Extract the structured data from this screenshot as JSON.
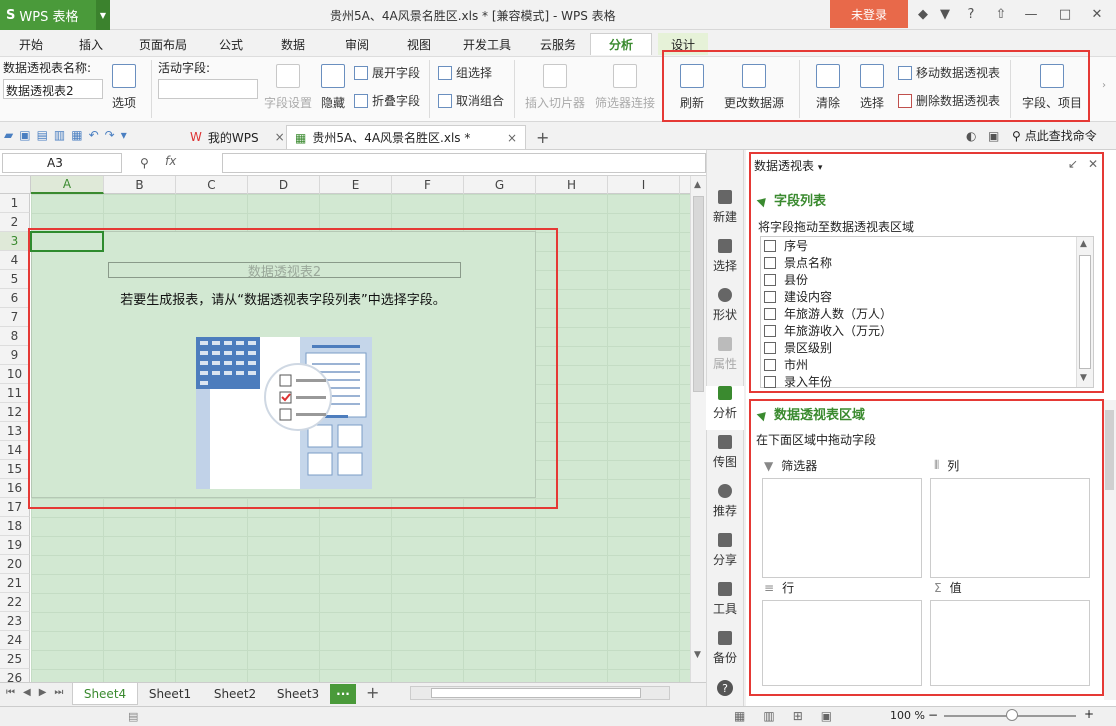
{
  "app": {
    "name": "WPS 表格",
    "doc_title": "贵州5A、4A风景名胜区.xls * [兼容模式] - WPS 表格",
    "login": "未登录"
  },
  "menu_tabs": [
    "开始",
    "插入",
    "页面布局",
    "公式",
    "数据",
    "审阅",
    "视图",
    "开发工具",
    "云服务",
    "分析",
    "设计"
  ],
  "ribbon": {
    "pivot_name_label": "数据透视表名称:",
    "pivot_name_value": "数据透视表2",
    "options": "选项",
    "active_field_label": "活动字段:",
    "field_settings": "字段设置",
    "hide": "隐藏",
    "expand_field": "展开字段",
    "collapse_field": "折叠字段",
    "group_select": "组选择",
    "ungroup": "取消组合",
    "insert_slicer": "插入切片器",
    "filter_connect": "筛选器连接",
    "refresh": "刷新",
    "change_source": "更改数据源",
    "clear": "清除",
    "select": "选择",
    "move_pivot": "移动数据透视表",
    "delete_pivot": "删除数据透视表",
    "fields_items": "字段、项目"
  },
  "file_tabs": {
    "mywps": "我的WPS",
    "file": "贵州5A、4A风景名胜区.xls *",
    "search": "点此查找命令"
  },
  "formula": {
    "namebox": "A3",
    "fx": "fx"
  },
  "grid": {
    "columns": [
      "A",
      "B",
      "C",
      "D",
      "E",
      "F",
      "G",
      "H",
      "I"
    ],
    "rows": [
      "1",
      "2",
      "3",
      "4",
      "5",
      "6",
      "7",
      "8",
      "9",
      "10",
      "11",
      "12",
      "13",
      "14",
      "15",
      "16",
      "17",
      "18",
      "19",
      "20",
      "21",
      "22",
      "23",
      "24",
      "25",
      "26"
    ],
    "pivot_name": "数据透视表2",
    "pivot_hint": "若要生成报表，请从“数据透视表字段列表”中选择字段。"
  },
  "sheets": [
    "Sheet4",
    "Sheet1",
    "Sheet2",
    "Sheet3"
  ],
  "sidebar": [
    "新建",
    "选择",
    "形状",
    "属性",
    "分析",
    "传图",
    "推荐",
    "分享",
    "工具",
    "备份"
  ],
  "panel": {
    "title": "数据透视表",
    "field_list_title": "字段列表",
    "drag_hint": "将字段拖动至数据透视表区域",
    "fields": [
      "序号",
      "景点名称",
      "县份",
      "建设内容",
      "年旅游人数（万人）",
      "年旅游收入（万元）",
      "景区级别",
      "市州",
      "录入年份"
    ],
    "area_title": "数据透视表区域",
    "area_hint": "在下面区域中拖动字段",
    "filter": "筛选器",
    "columns": "列",
    "rows": "行",
    "values": "值"
  },
  "status": {
    "zoom": "100 %"
  }
}
